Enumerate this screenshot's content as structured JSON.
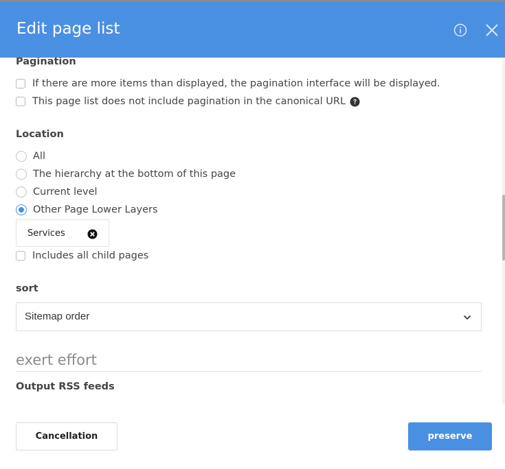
{
  "header": {
    "title": "Edit page list",
    "info_icon": "info-icon",
    "close_icon": "close-icon",
    "background_color": "#4a90e2"
  },
  "pagination": {
    "title": "Pagination",
    "options": [
      {
        "label": "If there are more items than displayed, the pagination interface will be displayed.",
        "checked": false
      },
      {
        "label": "This page list does not include pagination in the canonical URL",
        "checked": false,
        "help_icon": "question-circle-icon"
      }
    ]
  },
  "location": {
    "title": "Location",
    "options": [
      {
        "label": "All",
        "selected": false
      },
      {
        "label": "The hierarchy at the bottom of this page",
        "selected": false
      },
      {
        "label": "Current level",
        "selected": false
      },
      {
        "label": "Other Page Lower Layers",
        "selected": true
      }
    ],
    "selected_page": "Services",
    "include_children_label": "Includes all child pages",
    "include_children_checked": false
  },
  "sort": {
    "title": "sort",
    "value": "Sitemap order"
  },
  "legend": "exert effort",
  "rss": {
    "title": "Output RSS feeds"
  },
  "footer": {
    "cancel_label": "Cancellation",
    "save_label": "preserve",
    "accent_color": "#4a90e2"
  }
}
